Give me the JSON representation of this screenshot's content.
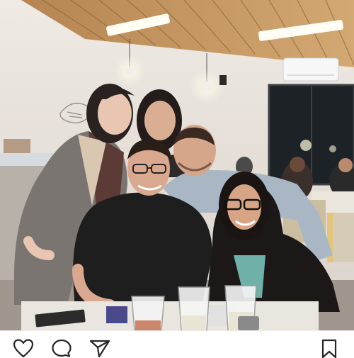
{
  "post": {
    "photo": {
      "subject": "group-photo",
      "scene": "restaurant-interior"
    },
    "actions": [
      {
        "icon": "heart-icon"
      },
      {
        "icon": "comment-icon"
      },
      {
        "icon": "share-icon"
      },
      {
        "icon": "bookmark-icon"
      }
    ]
  },
  "colors": {
    "icon_stroke": "#262626",
    "background": "#ffffff",
    "ceiling_wood": "#c79a62",
    "wall": "#e7e2dc"
  }
}
